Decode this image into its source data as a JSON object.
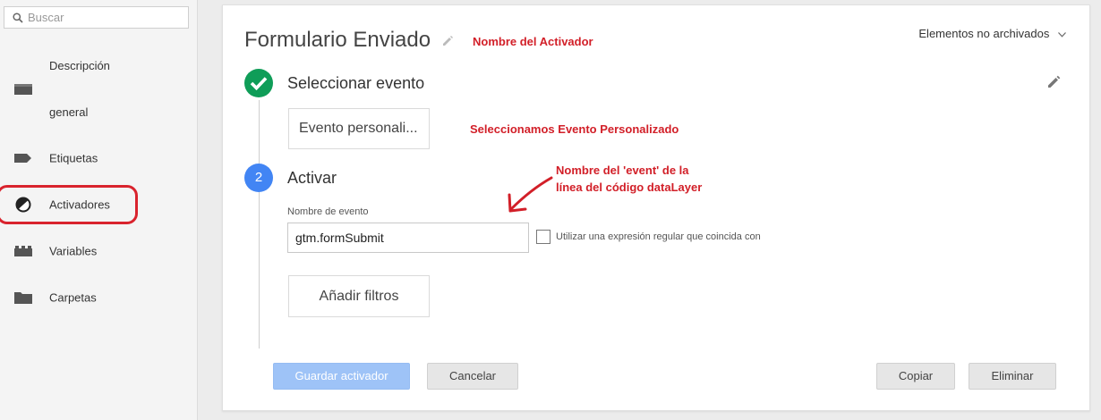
{
  "sidebar": {
    "search_placeholder": "Buscar",
    "items": [
      {
        "label_line1": "Descripción",
        "label_line2": "general",
        "icon": "folder-icon"
      },
      {
        "label": "Etiquetas",
        "icon": "tag-icon"
      },
      {
        "label": "Activadores",
        "icon": "trigger-icon",
        "highlighted": true
      },
      {
        "label": "Variables",
        "icon": "blocks-icon"
      },
      {
        "label": "Carpetas",
        "icon": "folder-icon"
      }
    ]
  },
  "header": {
    "title": "Formulario Enviado",
    "filter_label": "Elementos no archivados"
  },
  "annotations": {
    "trigger_name": "Nombre del Activador",
    "custom_event": "Seleccionamos Evento Personalizado",
    "event_name_line1": "Nombre del 'event' de la",
    "event_name_line2": "línea del código dataLayer",
    "color": "#d21f28"
  },
  "steps": {
    "select": {
      "title": "Seleccionar evento",
      "event_type": "Evento personali..."
    },
    "activate": {
      "number": "2",
      "title": "Activar",
      "event_name_label": "Nombre de evento",
      "event_name_value": "gtm.formSubmit",
      "regex_label": "Utilizar una expresión regular que coincida con",
      "add_filters": "Añadir filtros"
    }
  },
  "footer": {
    "save": "Guardar activador",
    "cancel": "Cancelar",
    "copy": "Copiar",
    "delete": "Eliminar"
  },
  "colors": {
    "done_green": "#0f9d58",
    "step_blue": "#4285f4",
    "save_disabled": "#9ec3f7",
    "highlight_red": "#d9232d"
  }
}
